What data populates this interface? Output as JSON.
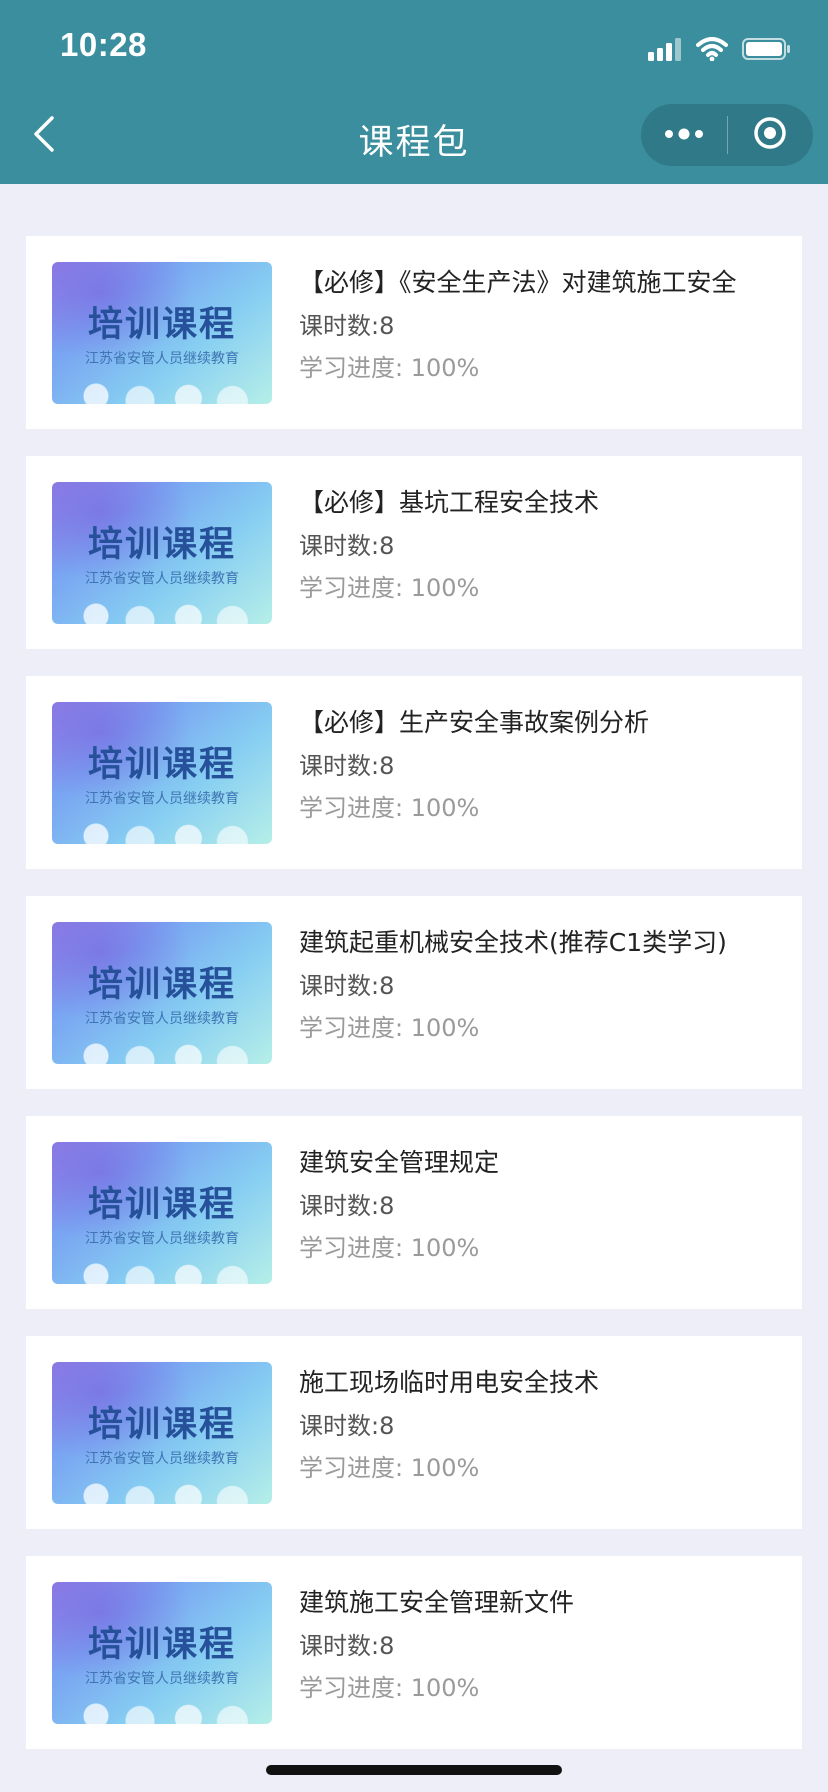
{
  "status_bar": {
    "time": "10:28"
  },
  "nav": {
    "title": "课程包"
  },
  "thumbnail": {
    "title": "培训课程",
    "subtitle": "江苏省安管人员继续教育"
  },
  "courses": [
    {
      "title": "【必修】《安全生产法》对建筑施工安全",
      "hours": "课时数:8",
      "progress": "学习进度: 100%"
    },
    {
      "title": "【必修】基坑工程安全技术",
      "hours": "课时数:8",
      "progress": "学习进度: 100%"
    },
    {
      "title": "【必修】生产安全事故案例分析",
      "hours": "课时数:8",
      "progress": "学习进度: 100%"
    },
    {
      "title": "建筑起重机械安全技术(推荐C1类学习)",
      "hours": "课时数:8",
      "progress": "学习进度: 100%"
    },
    {
      "title": "建筑安全管理规定",
      "hours": "课时数:8",
      "progress": "学习进度: 100%"
    },
    {
      "title": "施工现场临时用电安全技术",
      "hours": "课时数:8",
      "progress": "学习进度: 100%"
    },
    {
      "title": "建筑施工安全管理新文件",
      "hours": "课时数:8",
      "progress": "学习进度: 100%"
    }
  ],
  "colors": {
    "header": "#3b8e9e",
    "background": "#eeeef9",
    "card": "#ffffff"
  },
  "icons": {
    "back": "chevron-left-icon",
    "more": "more-dots-icon",
    "close": "target-circle-icon",
    "signal": "cellular-signal-icon",
    "wifi": "wifi-icon",
    "battery": "battery-icon"
  }
}
